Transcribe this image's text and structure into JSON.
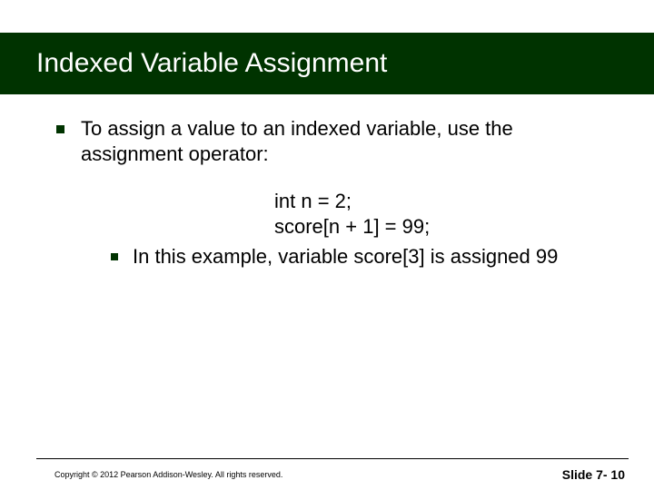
{
  "slide": {
    "title": "Indexed Variable Assignment",
    "main_bullet": "To assign a value to an indexed variable, use the assignment operator:",
    "code_line1": "int n = 2;",
    "code_line2": "score[n + 1] = 99;",
    "sub_bullet": "In this example, variable score[3] is assigned 99"
  },
  "footer": {
    "copyright": "Copyright © 2012 Pearson Addison-Wesley.  All rights reserved.",
    "slide_label": "Slide 7- 10"
  }
}
